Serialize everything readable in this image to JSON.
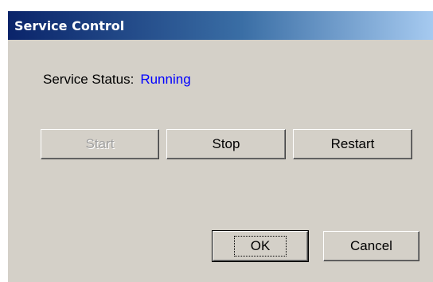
{
  "window": {
    "title": "Service Control"
  },
  "status": {
    "label": "Service Status:",
    "value": "Running",
    "value_color": "#0000ff"
  },
  "buttons": {
    "start": {
      "label": "Start",
      "enabled": false
    },
    "stop": {
      "label": "Stop",
      "enabled": true
    },
    "restart": {
      "label": "Restart",
      "enabled": true
    },
    "ok": {
      "label": "OK",
      "default": true
    },
    "cancel": {
      "label": "Cancel"
    }
  },
  "colors": {
    "titlebar_start": "#0a246a",
    "titlebar_end": "#a6caf0",
    "dialog_background": "#d4d0c8"
  }
}
